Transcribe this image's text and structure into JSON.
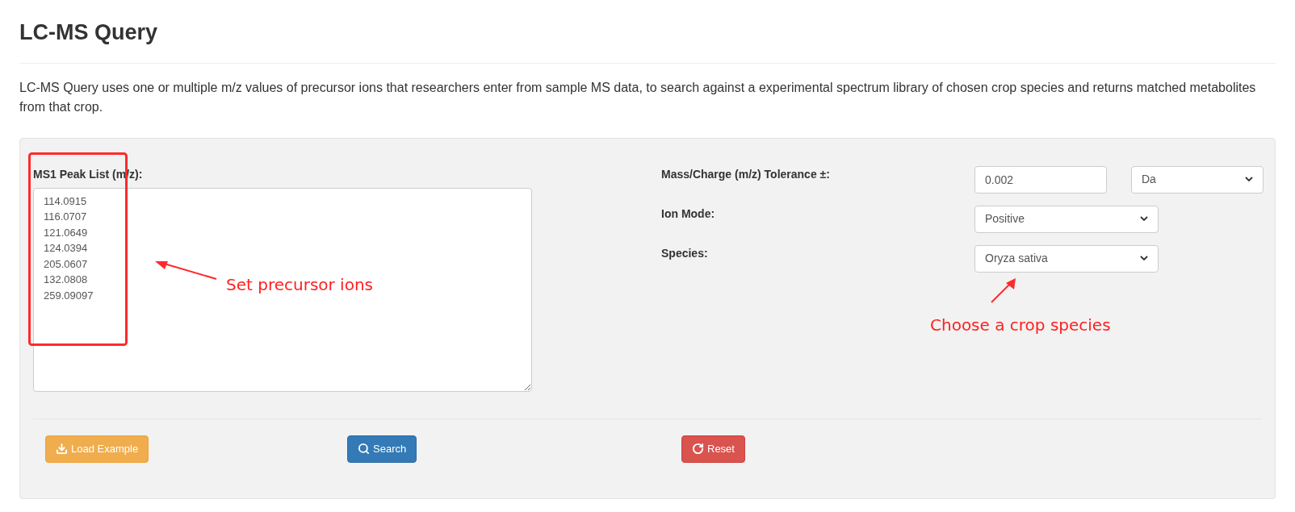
{
  "title": "LC-MS Query",
  "description": "LC-MS Query uses one or multiple m/z values of precursor ions that researchers enter from sample MS data, to search against a experimental spectrum library of chosen crop species and returns matched metabolites from that crop.",
  "peak_list": {
    "label": "MS1 Peak List (m/z):",
    "lines": [
      "114.0915",
      "116.0707",
      "121.0649",
      "124.0394",
      "205.0607",
      "132.0808",
      "259.09097"
    ]
  },
  "tolerance": {
    "label": "Mass/Charge (m/z) Tolerance ±:",
    "value": "0.002",
    "unit": "Da"
  },
  "ion_mode": {
    "label": "Ion Mode:",
    "value": "Positive"
  },
  "species": {
    "label": "Species:",
    "value": "Oryza sativa"
  },
  "buttons": [
    {
      "label": "Load Example",
      "kind": "load"
    },
    {
      "label": "Search",
      "kind": "search"
    },
    {
      "label": "Reset",
      "kind": "reset"
    }
  ],
  "annotations": [
    {
      "text": "Set precursor ions",
      "kind": "left"
    },
    {
      "text": "Choose a crop species",
      "kind": "up"
    }
  ]
}
